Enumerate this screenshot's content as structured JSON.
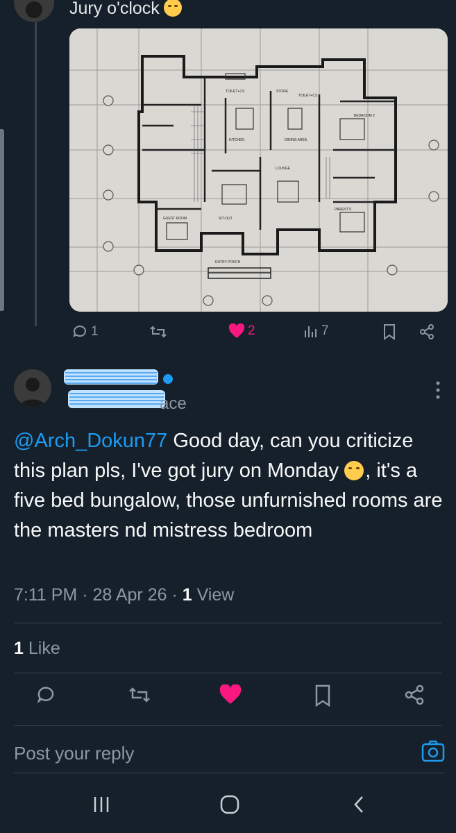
{
  "parent_tweet": {
    "text": "Jury o'clock",
    "emoji": "sneezing-face-emoji",
    "actions": {
      "replies": "1",
      "retweets": "",
      "likes": "2",
      "views": "7"
    }
  },
  "reply_tweet": {
    "handle_visible_fragment": "ace",
    "mention": "@Arch_Dokun77",
    "text": " Good day, can you criticize this plan pls, I've got jury on Monday ",
    "text_after_emoji": ", it's a five bed bungalow, those unfurnished rooms are the masters nd mistress bedroom",
    "emoji": "smiling-face-with-tear-emoji",
    "time": "7:11 PM",
    "date": "28 Apr 26",
    "view_count": "1",
    "view_label": "View",
    "separator": " · ",
    "like_count": "1",
    "like_label": "Like"
  },
  "floorplan_labels": {
    "toilet": "TOILET+CS",
    "store": "STORE",
    "toilet2": "TOILET+CS",
    "kitchen": "KITCHEN",
    "dining": "DINING AREA",
    "lounge": "LOUNGE",
    "bedroom2": "BEDROOM 2",
    "parents": "PARENT'S",
    "guest": "GUEST ROOM",
    "sitout": "SIT-OUT",
    "entry": "ENTRY PORCH"
  },
  "composer": {
    "placeholder": "Post your reply"
  },
  "colors": {
    "background": "#15202b",
    "text": "#f7f9f9",
    "muted": "#8b98a5",
    "accent": "#1d9bf0",
    "like": "#f91880",
    "divider": "#38444d"
  }
}
